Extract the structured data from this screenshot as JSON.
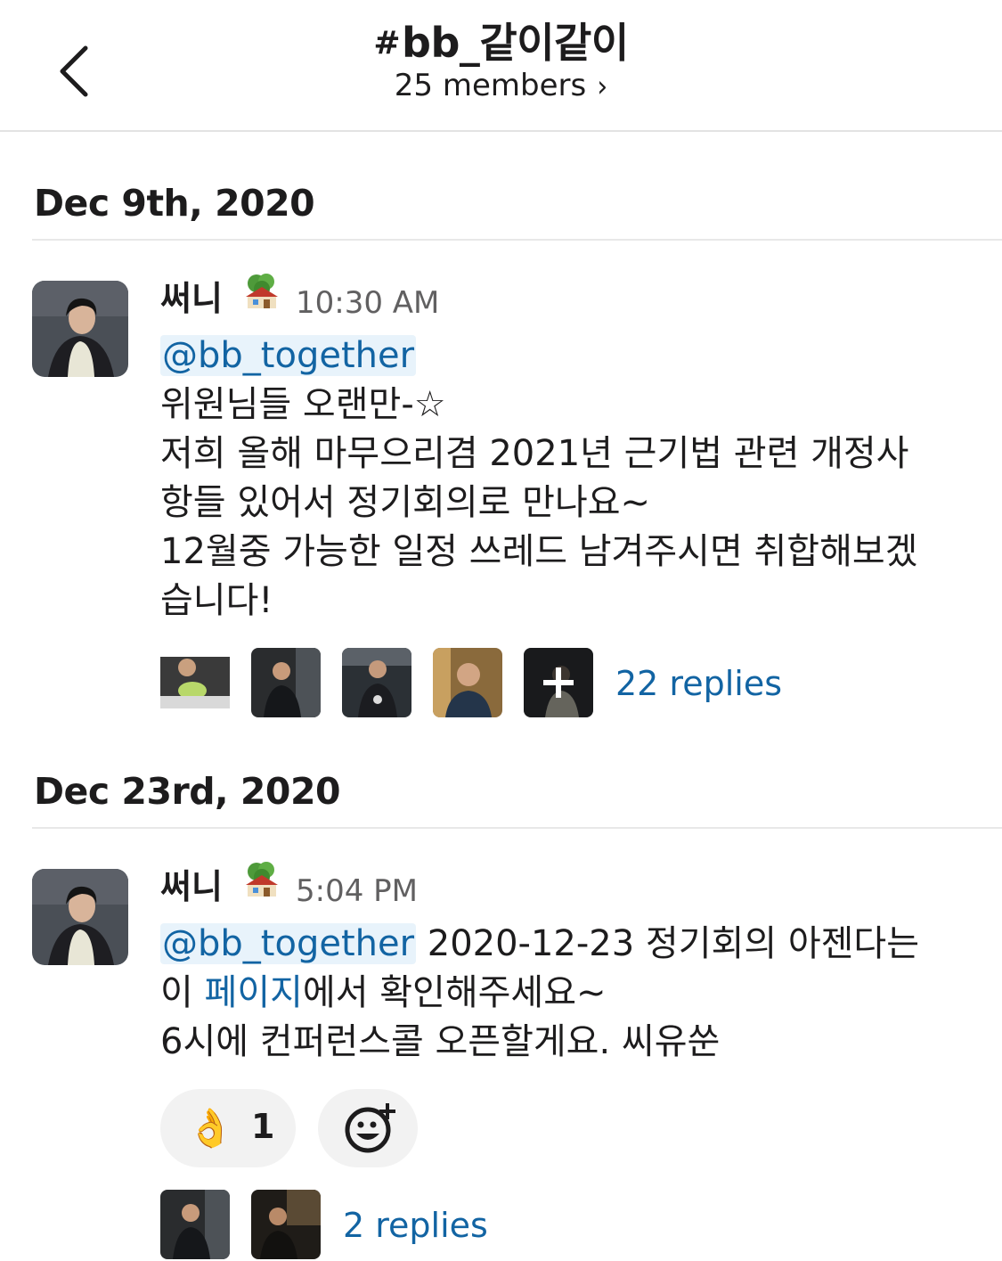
{
  "header": {
    "channel_hash": "#",
    "channel_name": "bb_같이같이",
    "members": "25 members",
    "members_chevron": "›"
  },
  "sections": [
    {
      "date": "Dec 9th, 2020",
      "message": {
        "author": "써니",
        "author_badge_icon": "tree-house-icon",
        "time": "10:30 AM",
        "mention": "@bb_together",
        "lines": [
          "위원님들 오랜만-☆",
          "저희 올해 마무으리겸 2021년 근기법 관련 개정사",
          "항들 있어서 정기회의로 만나요~",
          "12월중 가능한 일정 쓰레드 남겨주시면 취합해보겠",
          "습니다!"
        ],
        "replies": "22 replies"
      }
    },
    {
      "date": "Dec 23rd, 2020",
      "message": {
        "author": "써니",
        "author_badge_icon": "tree-house-icon",
        "time": "5:04 PM",
        "mention": "@bb_together",
        "line1_rest": " 2020-12-23 정기회의 아젠다는",
        "line2_pre": "이 ",
        "line2_link": "페이지",
        "line2_post": "에서 확인해주세요~",
        "line3": "6시에 컨퍼런스콜 오픈할게요. 씨유쑨",
        "reaction_emoji": "👌",
        "reaction_count": "1",
        "add_reaction_icon": "add-reaction-icon",
        "replies": "2 replies"
      }
    }
  ]
}
